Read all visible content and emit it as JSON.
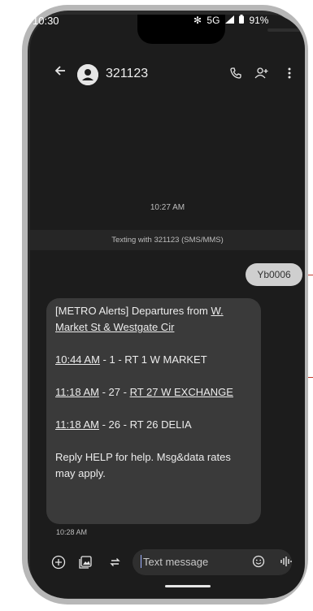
{
  "status_bar": {
    "time": "10:30",
    "bluetooth": "✻",
    "network": "5G",
    "battery": "91%"
  },
  "header": {
    "title": "321123",
    "back_icon": "arrow-left-icon",
    "call_icon": "phone-icon",
    "add_user_icon": "add-person-icon",
    "more_icon": "more-vert-icon"
  },
  "conversation": {
    "timestamp": "10:27 AM",
    "texting_with": "Texting with 321123 (SMS/MMS)",
    "sent_message": "Yb0006",
    "received": {
      "intro": "[METRO Alerts] Departures from ",
      "stop_link": "W. Market St & Westgate Cir",
      "lines": [
        {
          "time": "10:44 AM",
          "route_num": "1",
          "route_name": "RT 1 W MARKET",
          "route_linked": false
        },
        {
          "time": "11:18 AM",
          "route_num": "27",
          "route_name": "RT 27 W EXCHANGE",
          "route_linked": true
        },
        {
          "time": "11:18 AM",
          "route_num": "26",
          "route_name": "RT 26 DELIA",
          "route_linked": false
        }
      ],
      "footer": "Reply HELP for help. Msg&data rates may apply."
    },
    "received_time": "10:28 AM"
  },
  "composer": {
    "placeholder": "Text message",
    "add_icon": "add-circle-icon",
    "gallery_icon": "gallery-icon",
    "gif_icon": "sticker-icon",
    "emoji_icon": "emoji-icon",
    "voice_icon": "voice-icon"
  },
  "colors": {
    "screen_bg": "#1c1c1c",
    "received_bubble": "#3a3a3a",
    "sent_bubble": "#cfcfcf",
    "frame": "#b7b7b7"
  }
}
